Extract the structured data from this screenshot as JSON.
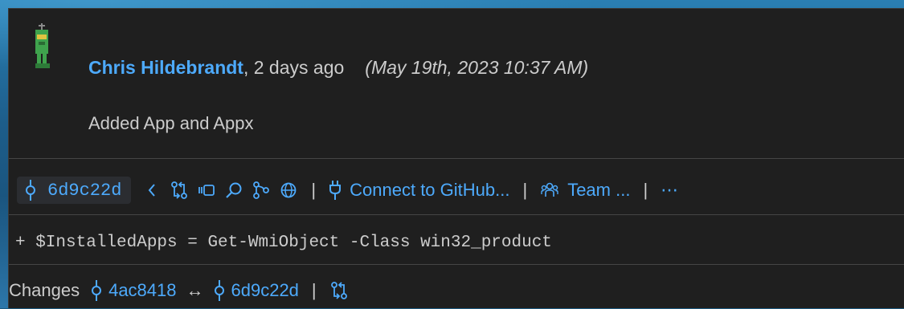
{
  "author": {
    "name": "Chris Hildebrandt",
    "relative_time": ", 2 days ago",
    "absolute_time": "(May 19th, 2023 10:37 AM)"
  },
  "commit": {
    "message": "Added App and Appx",
    "sha": "6d9c22d"
  },
  "actions": {
    "separator": "|",
    "connect_label": "Connect to GitHub...",
    "team_label": "Team ...",
    "more_label": "⋯"
  },
  "diff": {
    "line": "+ $InstalledApps = Get-WmiObject -Class win32_product"
  },
  "changes": {
    "label": "Changes",
    "from_sha": "4ac8418",
    "arrow": "↔",
    "to_sha": "6d9c22d",
    "separator": "|"
  },
  "colors": {
    "link": "#4daafc",
    "card_bg": "#1f1f1f",
    "text": "#cccccc"
  },
  "icons": [
    "commit-icon",
    "previous-icon",
    "compare-icon",
    "open-changes-icon",
    "search-icon",
    "graph-icon",
    "globe-icon",
    "plug-icon",
    "team-icon",
    "more-icon"
  ]
}
